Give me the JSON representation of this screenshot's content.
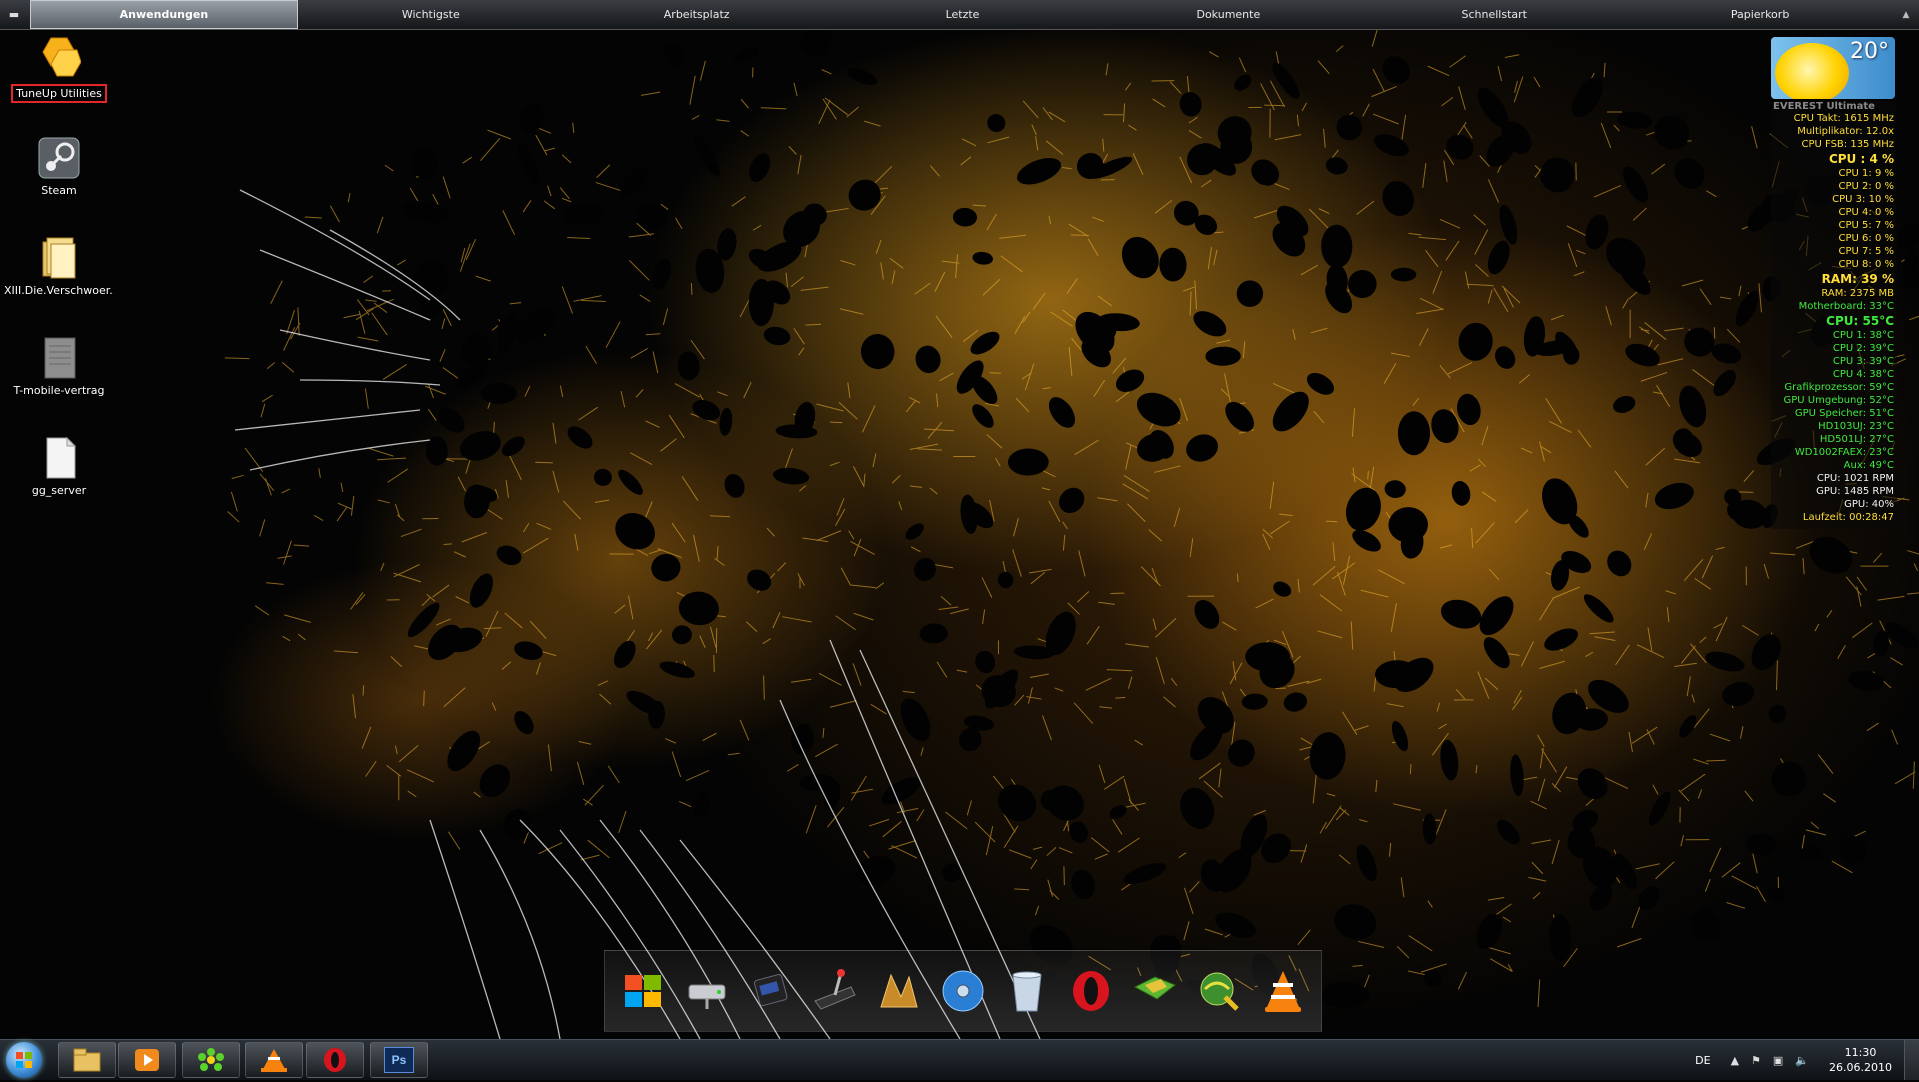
{
  "topbar": {
    "tabs": [
      "Anwendungen",
      "Wichtigste",
      "Arbeitsplatz",
      "Letzte",
      "Dokumente",
      "Schnellstart",
      "Papierkorb"
    ]
  },
  "desktop": {
    "icons": [
      {
        "label": "TuneUp Utilities",
        "icon": "tuneup-icon"
      },
      {
        "label": "Steam",
        "icon": "steam-icon"
      },
      {
        "label": "XIII.Die.Verschwoer...",
        "icon": "folder-icon"
      },
      {
        "label": "T-mobile-vertrag",
        "icon": "document-icon"
      },
      {
        "label": "gg_server",
        "icon": "file-icon"
      }
    ]
  },
  "weather": {
    "temperature": "20°"
  },
  "everest": {
    "title": "EVEREST Ultimate",
    "rows": [
      {
        "text": "CPU Takt: 1615 MHz",
        "color": "y"
      },
      {
        "text": "Multiplikator: 12.0x",
        "color": "y"
      },
      {
        "text": "CPU FSB: 135 MHz",
        "color": "y"
      },
      {
        "text": "CPU : 4 %",
        "color": "y",
        "big": true
      },
      {
        "text": "CPU 1: 9 %",
        "color": "y"
      },
      {
        "text": "CPU 2: 0 %",
        "color": "y"
      },
      {
        "text": "CPU 3: 10 %",
        "color": "y"
      },
      {
        "text": "CPU 4: 0 %",
        "color": "y"
      },
      {
        "text": "CPU 5: 7 %",
        "color": "y"
      },
      {
        "text": "CPU 6: 0 %",
        "color": "y"
      },
      {
        "text": "CPU 7: 5 %",
        "color": "y"
      },
      {
        "text": "CPU 8: 0 %",
        "color": "y"
      },
      {
        "text": "RAM: 39 %",
        "color": "y",
        "big": true
      },
      {
        "text": "RAM: 2375 MB",
        "color": "y"
      },
      {
        "text": "Motherboard: 33°C",
        "color": "g"
      },
      {
        "text": "CPU: 55°C",
        "color": "g",
        "big": true
      },
      {
        "text": "CPU 1: 38°C",
        "color": "g"
      },
      {
        "text": "CPU 2: 39°C",
        "color": "g"
      },
      {
        "text": "CPU 3: 39°C",
        "color": "g"
      },
      {
        "text": "CPU 4: 38°C",
        "color": "g"
      },
      {
        "text": "Grafikprozessor: 59°C",
        "color": "g"
      },
      {
        "text": "GPU Umgebung: 52°C",
        "color": "g"
      },
      {
        "text": "GPU Speicher: 51°C",
        "color": "g"
      },
      {
        "text": "HD103UJ: 23°C",
        "color": "g"
      },
      {
        "text": "HD501LJ: 27°C",
        "color": "g"
      },
      {
        "text": "WD1002FAEX: 23°C",
        "color": "g"
      },
      {
        "text": "Aux: 49°C",
        "color": "g"
      },
      {
        "text": "CPU: 1021 RPM",
        "color": "w"
      },
      {
        "text": "GPU: 1485 RPM",
        "color": "w"
      },
      {
        "text": "GPU: 40%",
        "color": "w"
      },
      {
        "text": "Laufzeit: 00:28:47",
        "color": "y"
      }
    ]
  },
  "dock": {
    "items": [
      "windows-icon",
      "network-drive-icon",
      "media-device-icon",
      "joystick-icon",
      "game-icon",
      "dvd-icon",
      "recycle-bin-icon",
      "opera-icon",
      "map-icon",
      "globe-icon",
      "vlc-icon"
    ]
  },
  "taskbar": {
    "pinned": [
      "explorer-icon",
      "media-player-icon",
      "icq-icon",
      "vlc-icon",
      "opera-icon",
      "photoshop-icon"
    ],
    "photoshop_label": "Ps",
    "language": "DE",
    "time": "11:30",
    "date": "26.06.2010"
  }
}
